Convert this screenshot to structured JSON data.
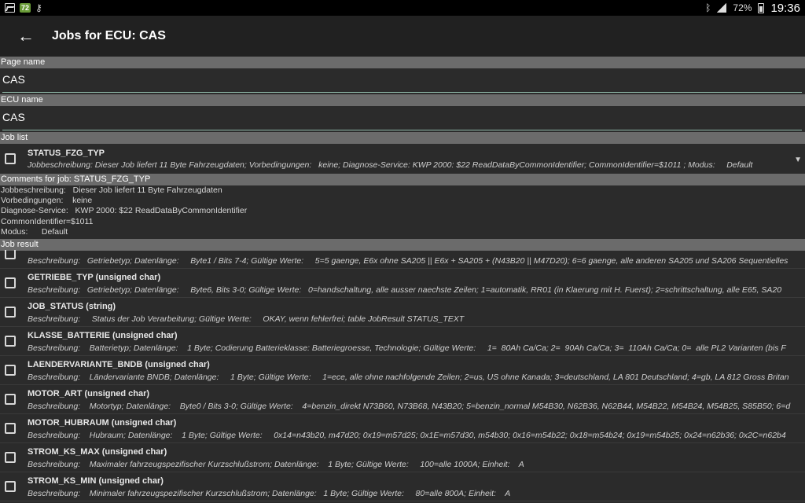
{
  "statusbar": {
    "badge": "72",
    "battery": "72%",
    "time": "19:36"
  },
  "appbar": {
    "title": "Jobs for ECU: CAS"
  },
  "page_name": {
    "label": "Page name",
    "value": "CAS"
  },
  "ecu_name": {
    "label": "ECU name",
    "value": "CAS"
  },
  "job_list": {
    "label": "Job list",
    "selected_title": "STATUS_FZG_TYP",
    "selected_desc": "Jobbeschreibung: Dieser Job liefert 11 Byte Fahrzeugdaten; Vorbedingungen:   keine; Diagnose-Service: KWP 2000: $22 ReadDataByCommonIdentifier; CommonIdentifier=$1011 ; Modus:     Default"
  },
  "comments": {
    "label": "Comments for job: STATUS_FZG_TYP",
    "lines": [
      "Jobbeschreibung:   Dieser Job liefert 11 Byte Fahrzeugdaten",
      "Vorbedingungen:    keine",
      "Diagnose-Service:   KWP 2000: $22 ReadDataByCommonIdentifier",
      "CommonIdentifier=$1011",
      "Modus:      Default"
    ]
  },
  "job_result": {
    "label": "Job result",
    "items": [
      {
        "title": "",
        "desc": "Beschreibung:   Getriebetyp; Datenlänge:     Byte1 / Bits 7-4; Gültige Werte:     5=5 gaenge, E6x ohne SA205 || E6x + SA205 + (N43B20 || M47D20); 6=6 gaenge, alle anderen SA205 und SA206 Sequentielles"
      },
      {
        "title": "GETRIEBE_TYP (unsigned char)",
        "desc": "Beschreibung:   Getriebetyp; Datenlänge:     Byte6, Bits 3-0; Gültige Werte:   0=handschaltung, alle ausser naechste Zeilen; 1=automatik, RR01 (in Klaerung mit H. Fuerst); 2=schrittschaltung, alle E65, SA20"
      },
      {
        "title": "JOB_STATUS (string)",
        "desc": "Beschreibung:     Status der Job Verarbeitung; Gültige Werte:     OKAY, wenn fehlerfrei; table JobResult STATUS_TEXT"
      },
      {
        "title": "KLASSE_BATTERIE (unsigned char)",
        "desc": "Beschreibung:    Batterietyp; Datenlänge:    1 Byte; Codierung Batterieklasse: Batteriegroesse, Technologie; Gültige Werte:     1=  80Ah Ca/Ca; 2=  90Ah Ca/Ca; 3=  110Ah Ca/Ca; 0=  alle PL2 Varianten (bis F"
      },
      {
        "title": "LAENDERVARIANTE_BNDB (unsigned char)",
        "desc": "Beschreibung:    Ländervariante BNDB; Datenlänge:     1 Byte; Gültige Werte:     1=ece, alle ohne nachfolgende Zeilen; 2=us, US ohne Kanada; 3=deutschland, LA 801 Deutschland; 4=gb, LA 812 Gross Britan"
      },
      {
        "title": "MOTOR_ART (unsigned char)",
        "desc": "Beschreibung:    Motortyp; Datenlänge:    Byte0 / Bits 3-0; Gültige Werte:    4=benzin_direkt N73B60, N73B68, N43B20; 5=benzin_normal M54B30, N62B36, N62B44, M54B22, M54B24, M54B25, S85B50; 6=d"
      },
      {
        "title": "MOTOR_HUBRAUM (unsigned char)",
        "desc": "Beschreibung:    Hubraum; Datenlänge:    1 Byte; Gültige Werte:     0x14=n43b20, m47d20; 0x19=m57d25; 0x1E=m57d30, m54b30; 0x16=m54b22; 0x18=m54b24; 0x19=m54b25; 0x24=n62b36; 0x2C=n62b4"
      },
      {
        "title": "STROM_KS_MAX (unsigned char)",
        "desc": "Beschreibung:    Maximaler fahrzeugspezifischer Kurzschlußstrom; Datenlänge:    1 Byte; Gültige Werte:     100=alle 1000A; Einheit:    A"
      },
      {
        "title": "STROM_KS_MIN (unsigned char)",
        "desc": "Beschreibung:    Minimaler fahrzeugspezifischer Kurzschlußstrom; Datenlänge:   1 Byte; Gültige Werte:     80=alle 800A; Einheit:    A"
      }
    ]
  }
}
